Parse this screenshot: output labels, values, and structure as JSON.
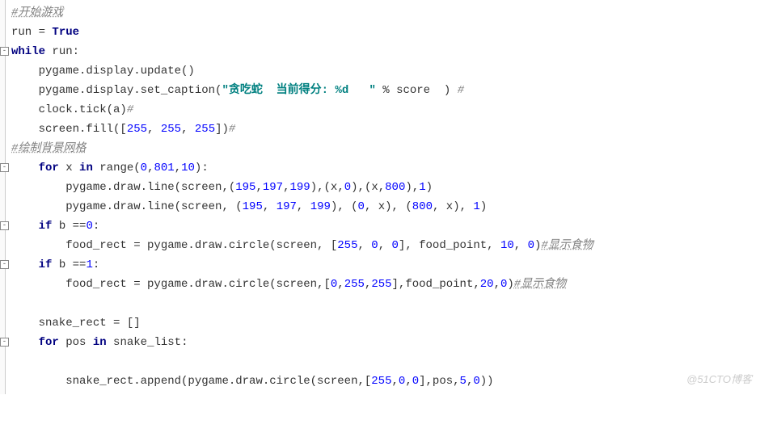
{
  "code": {
    "c1": "#开始游戏",
    "l2a": "run = ",
    "l2b": "True",
    "l3a": "while",
    "l3b": " run:",
    "l4": "    pygame.display.update()",
    "l5a": "    pygame.display.set_caption(",
    "l5b": "\"贪吃蛇  当前得分: %d   \"",
    "l5c": " % score  ) ",
    "l5d": "#",
    "l6": "    clock.tick(a)",
    "l6c": "#",
    "l7a": "    screen.fill([",
    "l7n1": "255",
    "l7s1": ", ",
    "l7n2": "255",
    "l7s2": ", ",
    "l7n3": "255",
    "l7e": "])",
    "l7c": "#",
    "c2": "#绘制背景网格",
    "l9a": "    ",
    "l9k": "for",
    "l9b": " x ",
    "l9in": "in",
    "l9c": " range(",
    "l9n1": "0",
    "l9s1": ",",
    "l9n2": "801",
    "l9s2": ",",
    "l9n3": "10",
    "l9e": "):",
    "l10a": "        pygame.draw.line(screen,(",
    "l10n1": "195",
    "l10s1": ",",
    "l10n2": "197",
    "l10s2": ",",
    "l10n3": "199",
    "l10m": "),(x,",
    "l10n4": "0",
    "l10m2": "),(x,",
    "l10n5": "800",
    "l10m3": "),",
    "l10n6": "1",
    "l10e": ")",
    "l11a": "        pygame.draw.line(screen, (",
    "l11n1": "195",
    "l11s1": ", ",
    "l11n2": "197",
    "l11s2": ", ",
    "l11n3": "199",
    "l11m": "), (",
    "l11n4": "0",
    "l11m2": ", x), (",
    "l11n5": "800",
    "l11m3": ", x), ",
    "l11n6": "1",
    "l11e": ")",
    "l12a": "    ",
    "l12k": "if",
    "l12b": " b ==",
    "l12n": "0",
    "l12c": ":",
    "l13a": "        food_rect = pygame.draw.circle(screen, [",
    "l13n1": "255",
    "l13s1": ", ",
    "l13n2": "0",
    "l13s2": ", ",
    "l13n3": "0",
    "l13m": "], food_point, ",
    "l13n4": "10",
    "l13m2": ", ",
    "l13n5": "0",
    "l13e": ")",
    "l13c": "#显示食物",
    "l14a": "    ",
    "l14k": "if",
    "l14b": " b ==",
    "l14n": "1",
    "l14c": ":",
    "l15a": "        food_rect = pygame.draw.circle(screen,[",
    "l15n1": "0",
    "l15s1": ",",
    "l15n2": "255",
    "l15s2": ",",
    "l15n3": "255",
    "l15m": "],food_point,",
    "l15n4": "20",
    "l15m2": ",",
    "l15n5": "0",
    "l15e": ")",
    "l15c": "#显示食物",
    "l16": "    snake_rect = []",
    "l17a": "    ",
    "l17k": "for",
    "l17b": " pos ",
    "l17in": "in",
    "l17c": " snake_list:",
    "l18a": "        snake_rect.append(pygame.draw.circle(screen,[",
    "l18n1": "255",
    "l18s1": ",",
    "l18n2": "0",
    "l18s2": ",",
    "l18n3": "0",
    "l18m": "],pos,",
    "l18n4": "5",
    "l18m2": ",",
    "l18n5": "0",
    "l18e": "))"
  },
  "watermark": "@51CTO博客"
}
